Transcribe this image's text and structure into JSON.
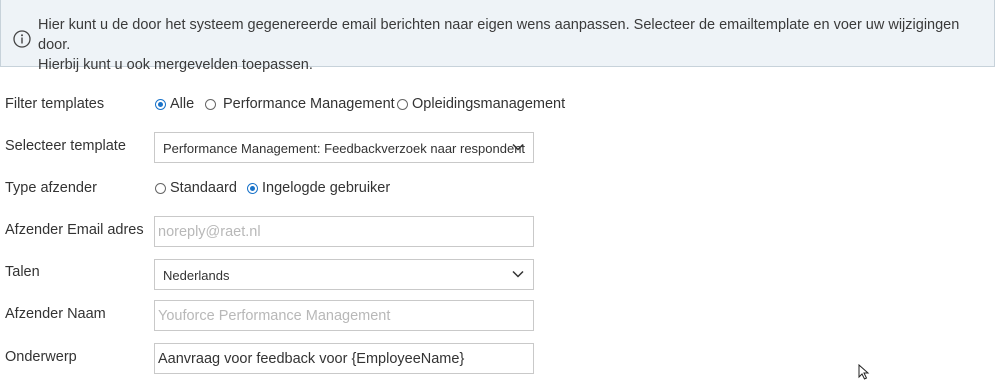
{
  "info": {
    "icon": "info-icon",
    "line1": "Hier kunt u de door het systeem gegenereerde email berichten naar eigen wens aanpassen. Selecteer de emailtemplate en voer uw wijzigingen door.",
    "line2": "Hierbij kunt u ook mergevelden toepassen."
  },
  "filter": {
    "label": "Filter templates",
    "options": [
      "Alle",
      "Performance Management",
      "Opleidingsmanagement"
    ],
    "selected": "Alle"
  },
  "template": {
    "label": "Selecteer template",
    "value": "Performance Management: Feedbackverzoek naar respondent"
  },
  "sender_type": {
    "label": "Type afzender",
    "options": [
      "Standaard",
      "Ingelogde gebruiker"
    ],
    "selected": "Ingelogde gebruiker"
  },
  "sender_email": {
    "label": "Afzender Email adres",
    "placeholder": "noreply@raet.nl"
  },
  "language": {
    "label": "Talen",
    "value": "Nederlands"
  },
  "sender_name": {
    "label": "Afzender Naam",
    "placeholder": "Youforce Performance Management"
  },
  "subject": {
    "label": "Onderwerp",
    "value": "Aanvraag voor feedback voor {EmployeeName}"
  },
  "colors": {
    "accent": "#1a73c9",
    "info_bg": "#eef3f7",
    "border": "#c9c9c9"
  }
}
